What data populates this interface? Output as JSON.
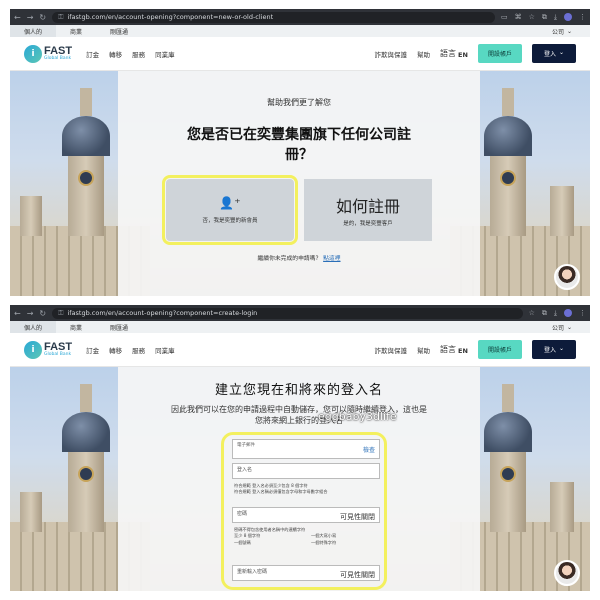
{
  "shot1": {
    "chrome": {
      "url": "ifastgb.com/en/account-opening?component=new-or-old-client"
    },
    "topbar": {
      "tabs": [
        "個人的",
        "商業",
        "剛匯通"
      ],
      "lang": "公司"
    },
    "header": {
      "logo_mark": "i",
      "logo_brand": "FAST",
      "logo_sub": "Global Bank",
      "menu": [
        "訂金",
        "轉移",
        "服務",
        "同業庫"
      ],
      "right": [
        "詐欺與保護",
        "幫助"
      ],
      "lang_label": "語言",
      "lang_code": "EN",
      "open_btn": "開設帳戶",
      "login_btn": "登入"
    },
    "panel": {
      "eyebrow": "幫助我們更了解您",
      "title": "您是否已在奕豐集團旗下任何公司註冊？",
      "card_new_title": "否，我是奕豐的新會員",
      "card_old_big": "如何註冊",
      "card_old_small": "是的，我是奕豐客戶",
      "foot_text": "繼續你未完成的申請嗎？",
      "foot_link": "點這裡"
    }
  },
  "shot2": {
    "chrome": {
      "url": "ifastgb.com/en/account-opening?component=create-login"
    },
    "topbar": {
      "tabs": [
        "個人的",
        "商業",
        "剛匯通"
      ],
      "lang": "公司"
    },
    "header": {
      "logo_mark": "i",
      "logo_brand": "FAST",
      "logo_sub": "Global Bank",
      "menu": [
        "訂金",
        "轉移",
        "服務",
        "同業庫"
      ],
      "right": [
        "詐欺與保護",
        "幫助"
      ],
      "lang_label": "語言",
      "lang_code": "EN",
      "open_btn": "開設帳戶",
      "login_btn": "登入"
    },
    "panel": {
      "title": "建立您現在和將來的登入名",
      "subtitle": "因此我們可以在您的申請過程中自動儲存，您可以隨時繼續登入，這也是您將來網上銀行的登入名",
      "watermark": "eggbaby3dlife",
      "email_label": "電子郵件",
      "email_action": "檢查",
      "username_placeholder": "登入名",
      "username_rules": [
        "符合規範 登入名必須至少包含 8 個字符",
        "符合規範 登入名稱必須僅包含字母和字母數字組合"
      ],
      "password_placeholder": "密碼",
      "password_action": "可見性關閉",
      "password_rules": [
        "密碼不得包含使用者名稱中的連續字符",
        "至少 8 個字符",
        "一個大寫小寫",
        "一個號碼",
        "一個特殊字符"
      ],
      "confirm_placeholder": "重新輸入密碼",
      "confirm_action": "可見性關閉"
    }
  }
}
